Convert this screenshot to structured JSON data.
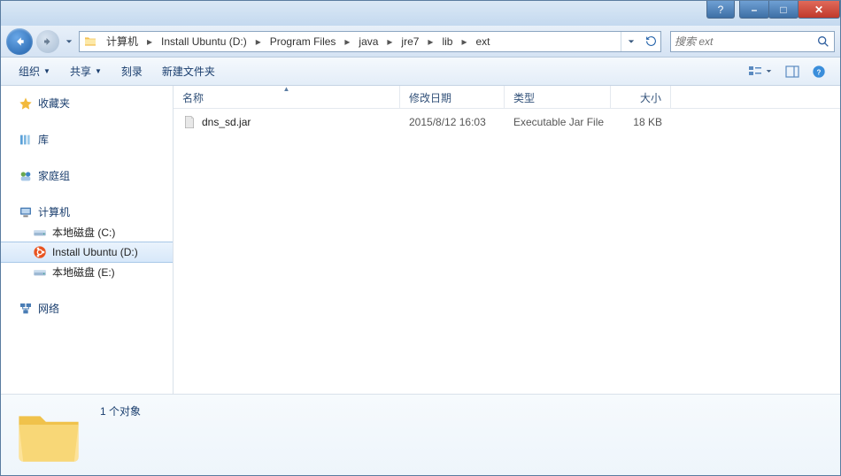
{
  "titlebar": {
    "question": "?",
    "minimize": "–",
    "maximize": "□",
    "close": "✕"
  },
  "nav": {
    "breadcrumbs": [
      "计算机",
      "Install Ubuntu (D:)",
      "Program Files",
      "java",
      "jre7",
      "lib",
      "ext"
    ]
  },
  "search": {
    "placeholder": "搜索 ext"
  },
  "toolbar": {
    "organize": "组织",
    "share": "共享",
    "burn": "刻录",
    "newfolder": "新建文件夹"
  },
  "columns": {
    "name": "名称",
    "date": "修改日期",
    "type": "类型",
    "size": "大小"
  },
  "sidebar": {
    "favorites": "收藏夹",
    "libraries": "库",
    "homegroup": "家庭组",
    "computer": "计算机",
    "drives": [
      {
        "label": "本地磁盘 (C:)"
      },
      {
        "label": "Install Ubuntu (D:)"
      },
      {
        "label": "本地磁盘 (E:)"
      }
    ],
    "network": "网络"
  },
  "files": [
    {
      "name": "dns_sd.jar",
      "date": "2015/8/12 16:03",
      "type": "Executable Jar File",
      "size": "18 KB"
    }
  ],
  "details": {
    "count_text": "1 个对象"
  }
}
